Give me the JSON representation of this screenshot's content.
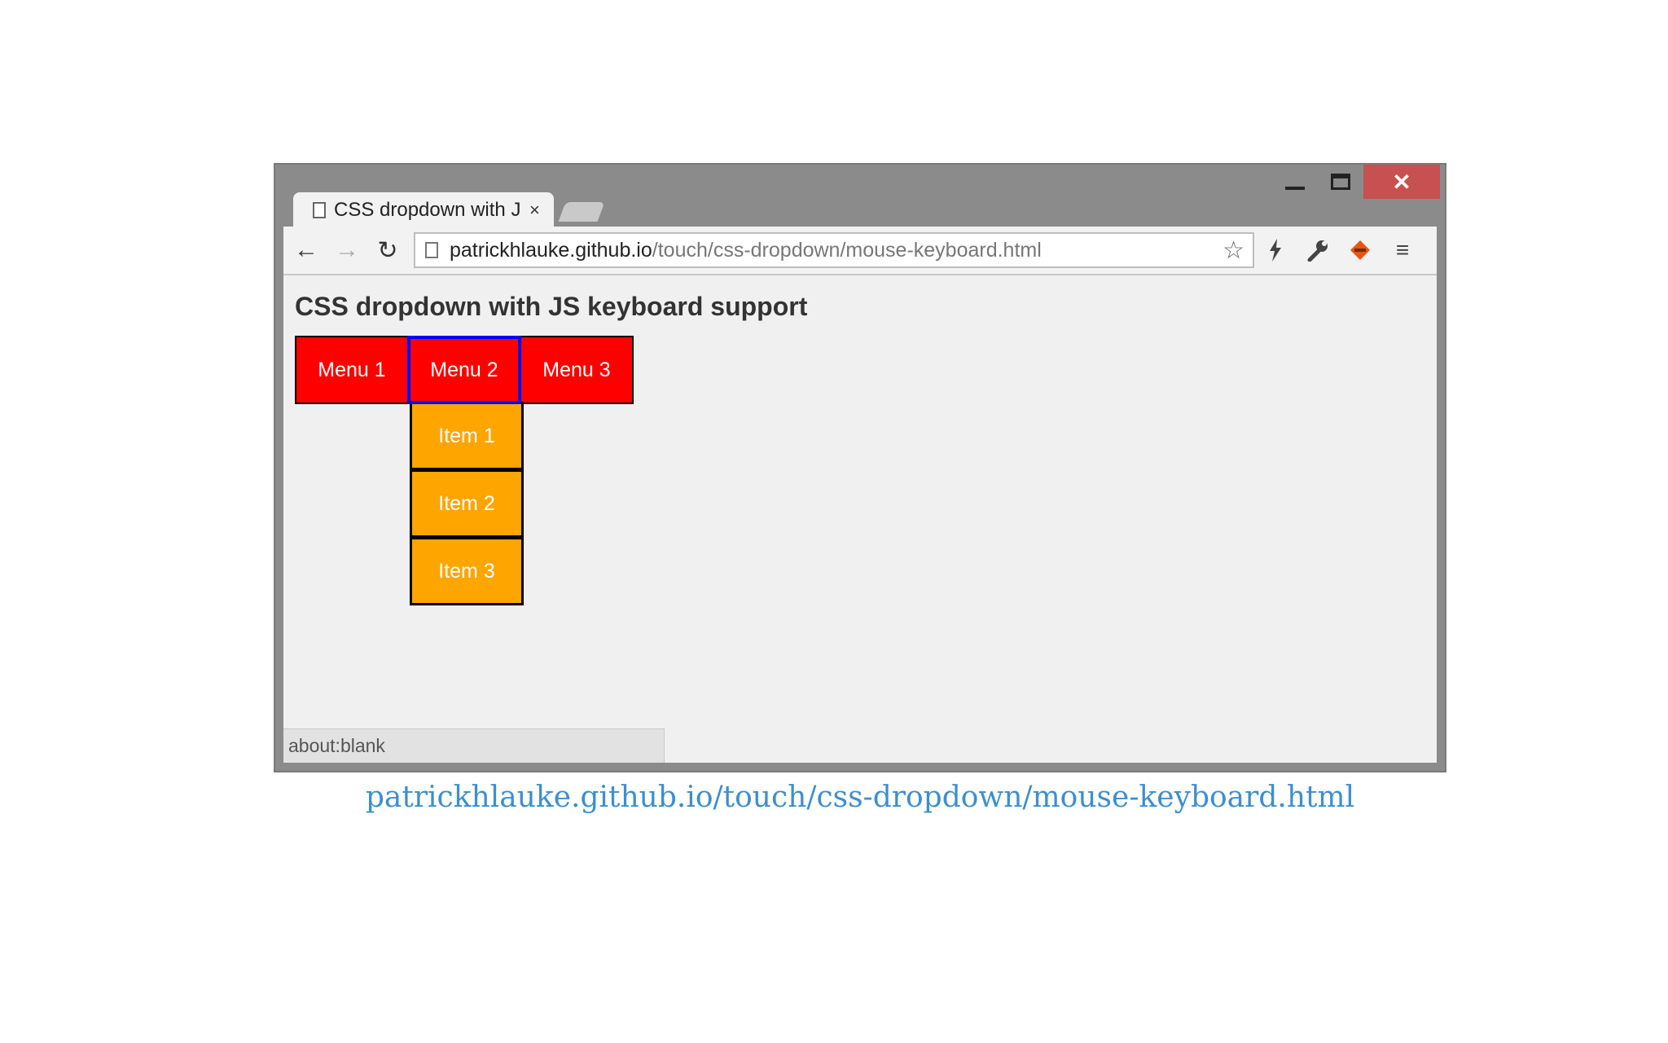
{
  "window": {
    "controls": {
      "minimize": "",
      "maximize": "",
      "close": "✕"
    },
    "tab": {
      "title": "CSS dropdown with JS keyboard support",
      "close": "×"
    }
  },
  "toolbar": {
    "back": "←",
    "forward": "→",
    "reload": "↻",
    "url_host": "patrickhlauke.github.io",
    "url_path": "/touch/css-dropdown/mouse-keyboard.html",
    "bookmark": "☆",
    "extensions": [
      "lightning-icon",
      "wrench-icon",
      "orange-diamond-icon"
    ],
    "menu": "≡"
  },
  "page": {
    "heading": "CSS dropdown with JS keyboard support",
    "menu": [
      "Menu 1",
      "Menu 2",
      "Menu 3"
    ],
    "focused_menu": "Menu 2",
    "submenu": [
      "Item 1",
      "Item 2",
      "Item 3"
    ],
    "colors": {
      "menu": "#ff0000",
      "submenu": "#ffa500",
      "focus": "#0000ff"
    }
  },
  "status": "about:blank",
  "caption": "patrickhlauke.github.io/touch/css-dropdown/mouse-keyboard.html"
}
